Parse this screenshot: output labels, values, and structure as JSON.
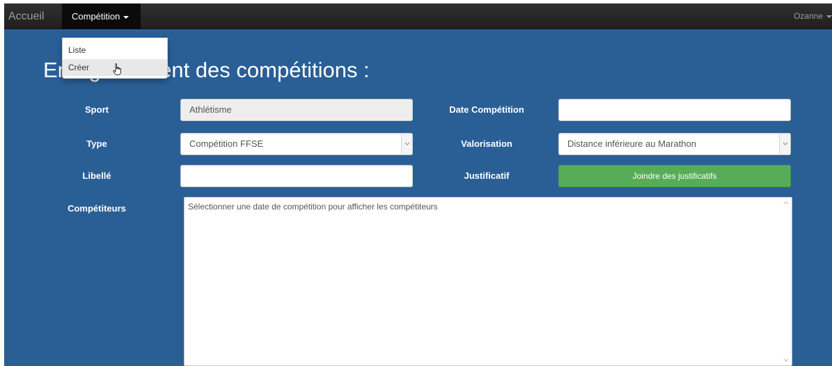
{
  "navbar": {
    "brand": "Accueil",
    "competition_menu": "Compétition",
    "user": "Ozanne"
  },
  "dropdown": {
    "items": [
      {
        "label": "Liste"
      },
      {
        "label": "Créer"
      }
    ]
  },
  "page": {
    "title": "Enregistrement des compétitions :"
  },
  "form": {
    "sport_label": "Sport",
    "sport_value": "Athlétisme",
    "date_label": "Date Compétition",
    "date_value": "",
    "type_label": "Type",
    "type_value": "Compétition FFSE",
    "valorisation_label": "Valorisation",
    "valorisation_value": "Distance inférieure au Marathon",
    "libelle_label": "Libellé",
    "libelle_value": "",
    "justificatif_label": "Justificatif",
    "justificatif_button": "Joindre des justificatifs",
    "competiteurs_label": "Compétiteurs",
    "competiteurs_text": "Sélectionner une date de compétition pour afficher les compétiteurs"
  },
  "colors": {
    "background": "#2a5f96",
    "navbar": "#222222",
    "success": "#57ad57"
  }
}
